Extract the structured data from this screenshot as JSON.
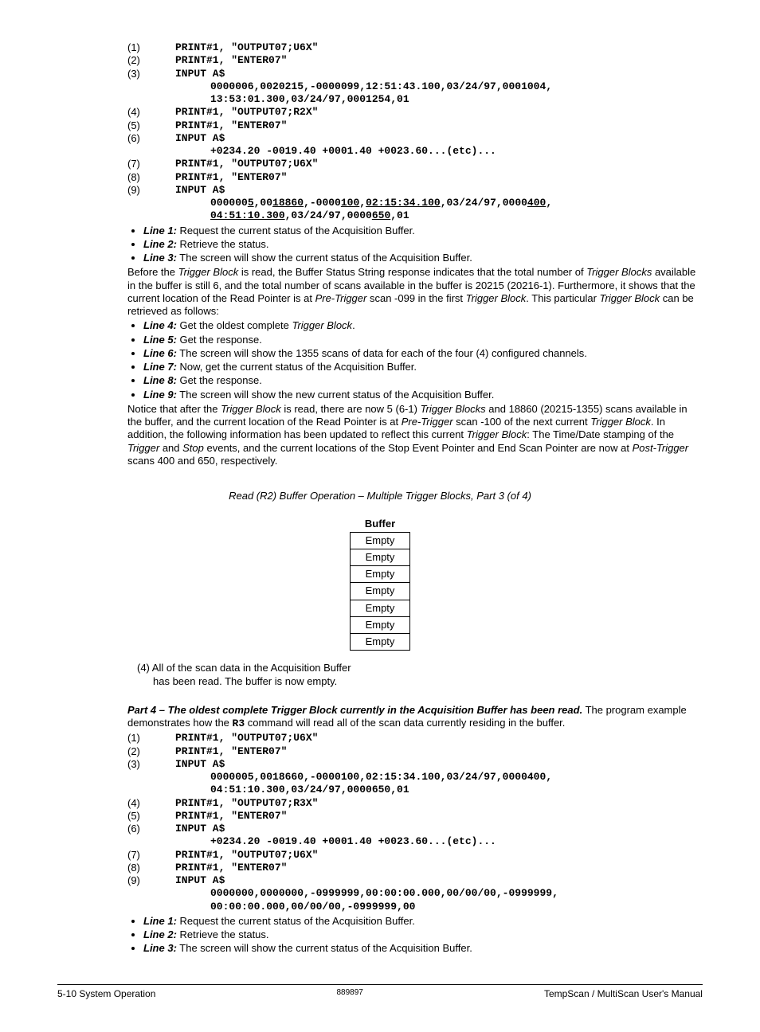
{
  "block1": {
    "l1": {
      "n": "(1)",
      "c": "PRINT#1, \"OUTPUT07;U6X\""
    },
    "l2": {
      "n": "(2)",
      "c": "PRINT#1, \"ENTER07\""
    },
    "l3": {
      "n": "(3)",
      "c": "INPUT A$"
    },
    "o3a": "0000006,0020215,-0000099,12:51:43.100,03/24/97,0001004,",
    "o3b": "13:53:01.300,03/24/97,0001254,01",
    "l4": {
      "n": "(4)",
      "c": "PRINT#1, \"OUTPUT07;R2X\""
    },
    "l5": {
      "n": "(5)",
      "c": "PRINT#1, \"ENTER07\""
    },
    "l6": {
      "n": "(6)",
      "c": "INPUT A$"
    },
    "o6": "+0234.20 -0019.40 +0001.40 +0023.60...(etc)...",
    "l7": {
      "n": "(7)",
      "c": "PRINT#1, \"OUTPUT07;U6X\""
    },
    "l8": {
      "n": "(8)",
      "c": "PRINT#1, \"ENTER07\""
    },
    "l9": {
      "n": "(9)",
      "c": "INPUT A$"
    },
    "o9a_1": "000000",
    "o9a_2": "5",
    "o9a_3": ",00",
    "o9a_4": "18860",
    "o9a_5": ",-0000",
    "o9a_6": "100",
    "o9a_7": ",",
    "o9a_8": "02:15:34.100",
    "o9a_9": ",03/24/97,0000",
    "o9a_10": "400",
    "o9a_11": ",",
    "o9b_1": "04:51:10.300",
    "o9b_2": ",03/24/97,0000",
    "o9b_3": "650",
    "o9b_4": ",01"
  },
  "bullets1": {
    "b1": {
      "lbl": "Line 1:",
      "txt": " Request the current status of the Acquisition Buffer."
    },
    "b2": {
      "lbl": "Line 2:",
      "txt": " Retrieve the status."
    },
    "b3": {
      "lbl": "Line 3:",
      "txt": " The screen will show the current status of the Acquisition Buffer."
    }
  },
  "para1": {
    "p1": "Before the ",
    "p2": "Trigger Block",
    "p3": " is read, the Buffer Status String response indicates that the total number of ",
    "p4": "Trigger Blocks",
    "p5": " available in the buffer is still 6, and the total number of scans available in the buffer is 20215 (20216-1).  Furthermore, it shows that the current location of the Read Pointer is at ",
    "p6": "Pre-Trigger",
    "p7": " scan -099 in the first ",
    "p8": "Trigger Block",
    "p9": ".  This particular ",
    "p10": "Trigger Block",
    "p11": " can be retrieved as follows:"
  },
  "bullets2": {
    "b4": {
      "lbl": "Line 4:",
      "t1": " Get the oldest complete ",
      "t2": "Trigger Block",
      "t3": "."
    },
    "b5": {
      "lbl": "Line 5:",
      "txt": " Get the response."
    },
    "b6": {
      "lbl": "Line 6:",
      "txt": " The screen will show the 1355 scans of data for each of the four (4) configured channels."
    },
    "b7": {
      "lbl": "Line 7:",
      "txt": " Now, get the current status of the Acquisition Buffer."
    },
    "b8": {
      "lbl": "Line 8:",
      "txt": " Get the response."
    },
    "b9": {
      "lbl": "Line 9:",
      "txt": " The screen will show the new current status of the Acquisition Buffer."
    }
  },
  "para2": {
    "p1": "Notice that after the ",
    "p2": "Trigger Block",
    "p3": " is read, there are now 5 (6-1) ",
    "p4": "Trigger Blocks",
    "p5": " and 18860 (20215-1355) scans available in the buffer, and the current location of the Read Pointer is at ",
    "p6": "Pre-Trigger",
    "p7": " scan -100 of the next current ",
    "p8": "Trigger Block",
    "p9": ".  In addition, the following information has been updated to reflect this current ",
    "p10": "Trigger Block",
    "p11": ": The Time/Date stamping of the ",
    "p12": "Trigger",
    "p13": " and ",
    "p14": "Stop",
    "p15": " events, and the current locations of the Stop Event Pointer and End Scan Pointer are now at ",
    "p16": "Post-Trigger",
    "p17": " scans 400 and 650, respectively."
  },
  "caption": "Read (R2) Buffer Operation – Multiple Trigger Blocks, Part 3 (of 4)",
  "buffer": {
    "header": "Buffer",
    "rows": [
      "Empty",
      "Empty",
      "Empty",
      "Empty",
      "Empty",
      "Empty",
      "Empty"
    ]
  },
  "bufnote": {
    "l1": "(4) All of the scan data in the Acquisition Buffer",
    "l2": "has been read.  The buffer is now empty."
  },
  "part4": {
    "hdr": "Part 4 – The oldest complete Trigger Block currently in the Acquisition Buffer has been read.",
    "tail1": "  The program example demonstrates how the ",
    "r3": "R3",
    "tail2": " command will read all of the scan data currently residing in the buffer."
  },
  "block2": {
    "l1": {
      "n": "(1)",
      "c": "PRINT#1, \"OUTPUT07;U6X\""
    },
    "l2": {
      "n": "(2)",
      "c": "PRINT#1, \"ENTER07\""
    },
    "l3": {
      "n": "(3)",
      "c": "INPUT A$"
    },
    "o3a": "0000005,0018660,-0000100,02:15:34.100,03/24/97,0000400,",
    "o3b": "04:51:10.300,03/24/97,0000650,01",
    "l4": {
      "n": "(4)",
      "c": "PRINT#1, \"OUTPUT07;R3X\""
    },
    "l5": {
      "n": "(5)",
      "c": "PRINT#1, \"ENTER07\""
    },
    "l6": {
      "n": "(6)",
      "c": "INPUT A$"
    },
    "o6": "+0234.20 -0019.40 +0001.40 +0023.60...(etc)...",
    "l7": {
      "n": "(7)",
      "c": "PRINT#1, \"OUTPUT07;U6X\""
    },
    "l8": {
      "n": "(8)",
      "c": "PRINT#1, \"ENTER07\""
    },
    "l9": {
      "n": "(9)",
      "c": "INPUT A$"
    },
    "o9a": "0000000,0000000,-0999999,00:00:00.000,00/00/00,-0999999,",
    "o9b": "00:00:00.000,00/00/00,-0999999,00"
  },
  "bullets3": {
    "b1": {
      "lbl": "Line 1:",
      "txt": " Request the current status of the Acquisition Buffer."
    },
    "b2": {
      "lbl": "Line 2:",
      "txt": " Retrieve the status."
    },
    "b3": {
      "lbl": "Line 3:",
      "txt": " The screen will show the current status of the Acquisition Buffer."
    }
  },
  "footer": {
    "left": "5-10    System Operation",
    "center": "889897",
    "right": "TempScan / MultiScan User's Manual"
  }
}
